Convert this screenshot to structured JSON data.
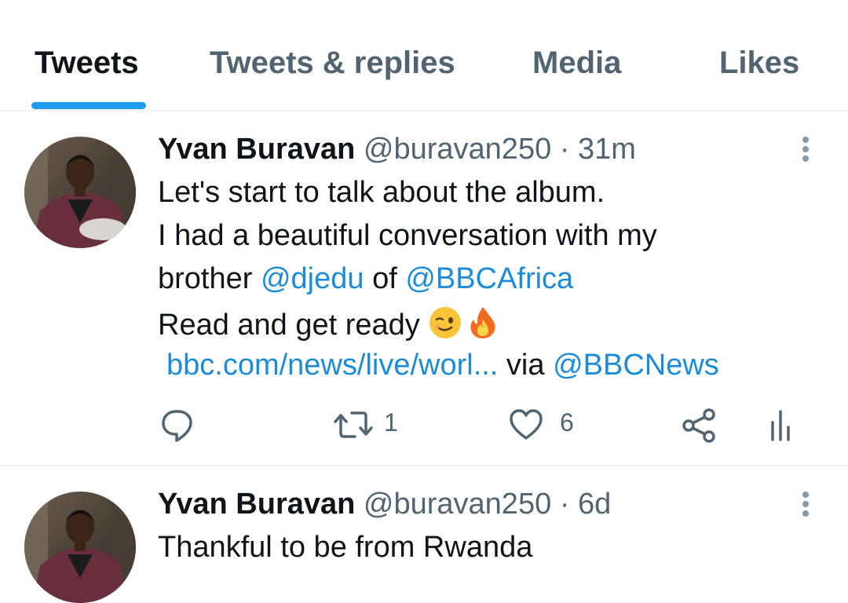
{
  "tabs": [
    {
      "label": "Tweets",
      "active": true
    },
    {
      "label": "Tweets & replies",
      "active": false
    },
    {
      "label": "Media",
      "active": false
    },
    {
      "label": "Likes",
      "active": false
    }
  ],
  "tweets": [
    {
      "name": "Yvan Buravan",
      "handle": "@buravan250",
      "separator": "·",
      "time": "31m",
      "text": {
        "line1": "Let's start to talk about the album.",
        "line2": "I had a beautiful conversation with my",
        "line3_prefix": "brother ",
        "mention1": "@djedu",
        "line3_mid": " of ",
        "mention2": "@BBCAfrica",
        "line4": "Read and get ready ",
        "link": "bbc.com/news/live/worl...",
        "via": " via ",
        "mention3": "@BBCNews"
      },
      "emojis": [
        "winking-face-emoji",
        "fire-emoji"
      ],
      "actions": {
        "reply_count": "",
        "retweet_count": "1",
        "like_count": "6"
      }
    },
    {
      "name": "Yvan Buravan",
      "handle": "@buravan250",
      "separator": "·",
      "time": "6d",
      "text": {
        "line1": "Thankful to be from Rwanda"
      }
    }
  ],
  "colors": {
    "accent": "#1d9bf0",
    "link": "#1d8cd8",
    "secondary_text": "#536471",
    "primary_text": "#0f1419"
  }
}
